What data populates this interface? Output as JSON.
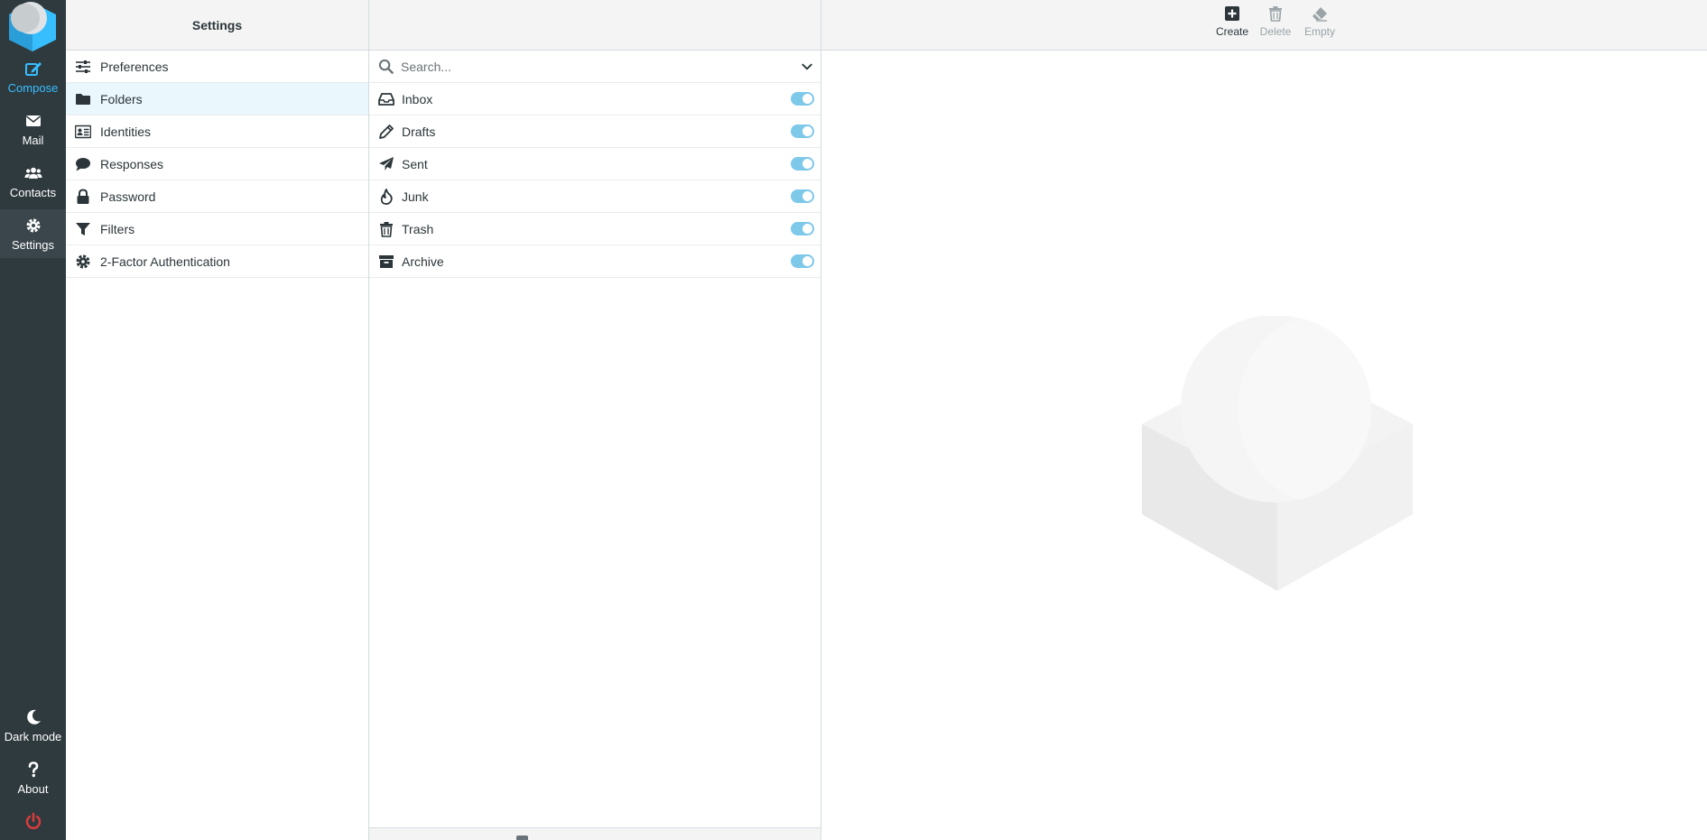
{
  "nav": {
    "compose": "Compose",
    "mail": "Mail",
    "contacts": "Contacts",
    "settings": "Settings",
    "dark_mode": "Dark mode",
    "about": "About"
  },
  "settings": {
    "title": "Settings",
    "items": [
      {
        "label": "Preferences",
        "icon": "sliders-icon"
      },
      {
        "label": "Folders",
        "icon": "folder-icon"
      },
      {
        "label": "Identities",
        "icon": "id-card-icon"
      },
      {
        "label": "Responses",
        "icon": "comment-icon"
      },
      {
        "label": "Password",
        "icon": "lock-icon"
      },
      {
        "label": "Filters",
        "icon": "filter-icon"
      },
      {
        "label": "2-Factor Authentication",
        "icon": "gear-icon"
      }
    ],
    "selected": "Folders"
  },
  "folders": {
    "search_placeholder": "Search...",
    "items": [
      {
        "label": "Inbox",
        "icon": "inbox-icon",
        "subscribed": true
      },
      {
        "label": "Drafts",
        "icon": "pencil-icon",
        "subscribed": true
      },
      {
        "label": "Sent",
        "icon": "paper-plane-icon",
        "subscribed": true
      },
      {
        "label": "Junk",
        "icon": "fire-icon",
        "subscribed": true
      },
      {
        "label": "Trash",
        "icon": "trash-icon",
        "subscribed": true
      },
      {
        "label": "Archive",
        "icon": "archive-icon",
        "subscribed": true
      }
    ]
  },
  "toolbar": {
    "create": "Create",
    "delete": "Delete",
    "empty": "Empty"
  },
  "colors": {
    "nav_bg": "#2f3a3f",
    "accent": "#37beff",
    "toggle_on": "#7ec8ea",
    "selected_row": "#eaf7fd",
    "logout": "#e03b3b"
  }
}
